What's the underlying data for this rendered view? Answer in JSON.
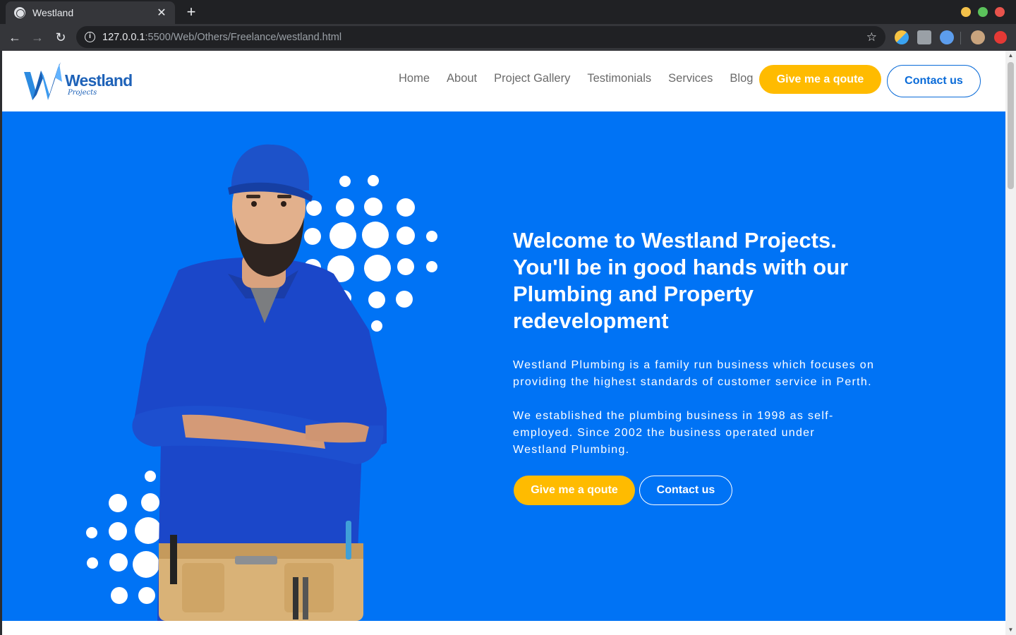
{
  "browser": {
    "tab_title": "Westland",
    "tab_close": "✕",
    "new_tab": "+",
    "url_host": "127.0.0.1",
    "url_path": ":5500/Web/Others/Freelance/westland.html",
    "back": "←",
    "forward": "→",
    "reload": "↻",
    "info": "i",
    "star": "☆",
    "window_dot_colors": [
      "#f4c14a",
      "#5bc25b",
      "#e8534c"
    ]
  },
  "header": {
    "logo_text": "Westland",
    "logo_sub": "Projects",
    "nav": [
      {
        "label": "Home"
      },
      {
        "label": "About"
      },
      {
        "label": "Project Gallery"
      },
      {
        "label": "Testimonials"
      },
      {
        "label": "Services"
      },
      {
        "label": "Blog"
      }
    ],
    "quote_button": "Give me a qoute",
    "contact_button": "Contact us"
  },
  "hero": {
    "title": "Welcome to Westland Projects. You'll be in good hands with our Plumbing and Property redevelopment",
    "paragraph_1": "Westland Plumbing is a family run business which focuses on providing the highest standards of customer service in Perth.",
    "paragraph_2": "We established the plumbing business in 1998 as self-employed. Since 2002 the business operated under Westland Plumbing.",
    "quote_button": "Give me a qoute",
    "contact_button": "Contact us"
  },
  "colors": {
    "brand_blue": "#0073f5",
    "accent_yellow": "#ffbb00",
    "logo_blue": "#1e62b8"
  }
}
